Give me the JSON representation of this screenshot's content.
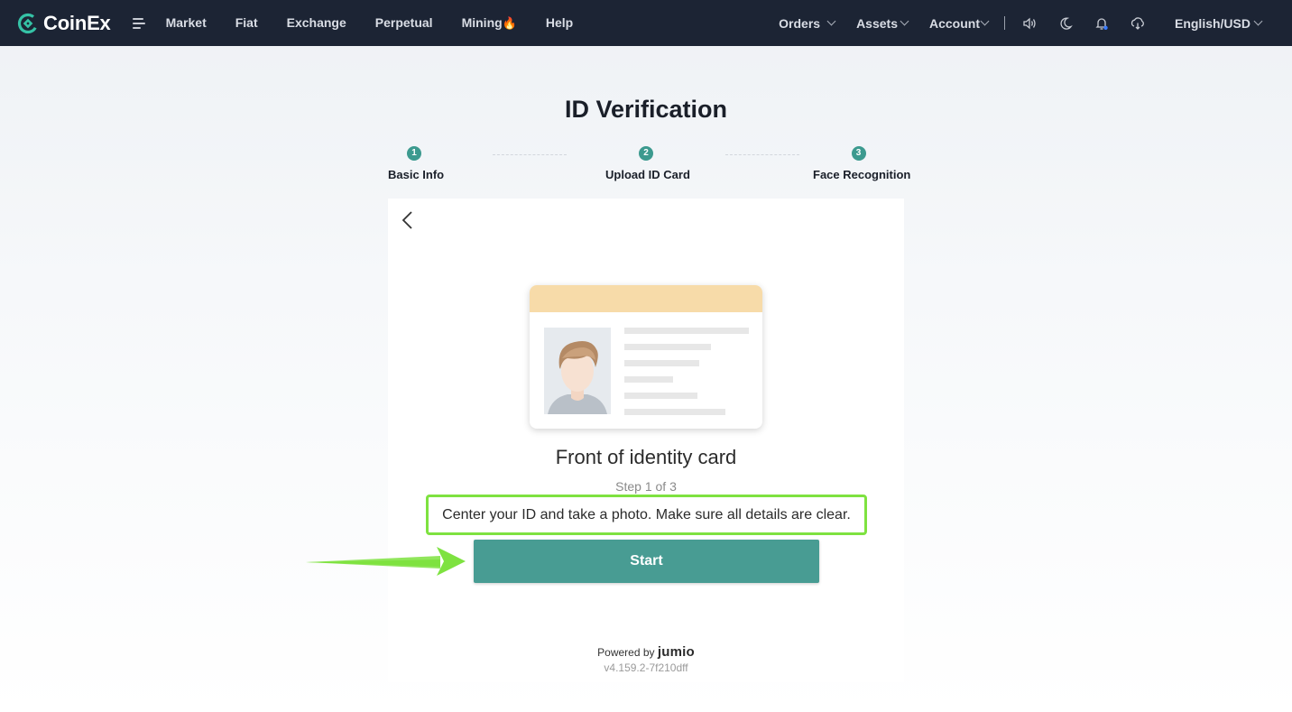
{
  "header": {
    "logo_text": "CoinEx",
    "nav": [
      {
        "label": "Market"
      },
      {
        "label": "Fiat"
      },
      {
        "label": "Exchange"
      },
      {
        "label": "Perpetual"
      },
      {
        "label": "Mining",
        "badge_icon": "flame-icon"
      },
      {
        "label": "Help"
      }
    ],
    "orders_label": "Orders",
    "assets_label": "Assets",
    "account_label": "Account",
    "language_label": "English/USD"
  },
  "page": {
    "title": "ID Verification"
  },
  "stepper": {
    "steps": [
      {
        "number": "1",
        "label": "Basic Info"
      },
      {
        "number": "2",
        "label": "Upload ID Card"
      },
      {
        "number": "3",
        "label": "Face Recognition"
      }
    ]
  },
  "verification": {
    "title": "Front of identity card",
    "step_text": "Step 1 of 3",
    "hint": "Center your ID and take a photo. Make sure all details are clear.",
    "start_label": "Start",
    "powered_by": "Powered by",
    "brand": "jumio",
    "version": "v4.159.2-7f210dff"
  },
  "colors": {
    "nav_bg": "#1c2434",
    "accent": "#489c93",
    "step_accent": "#3c9a8f",
    "highlight": "#7ee240",
    "card_header": "#f7dba9"
  }
}
